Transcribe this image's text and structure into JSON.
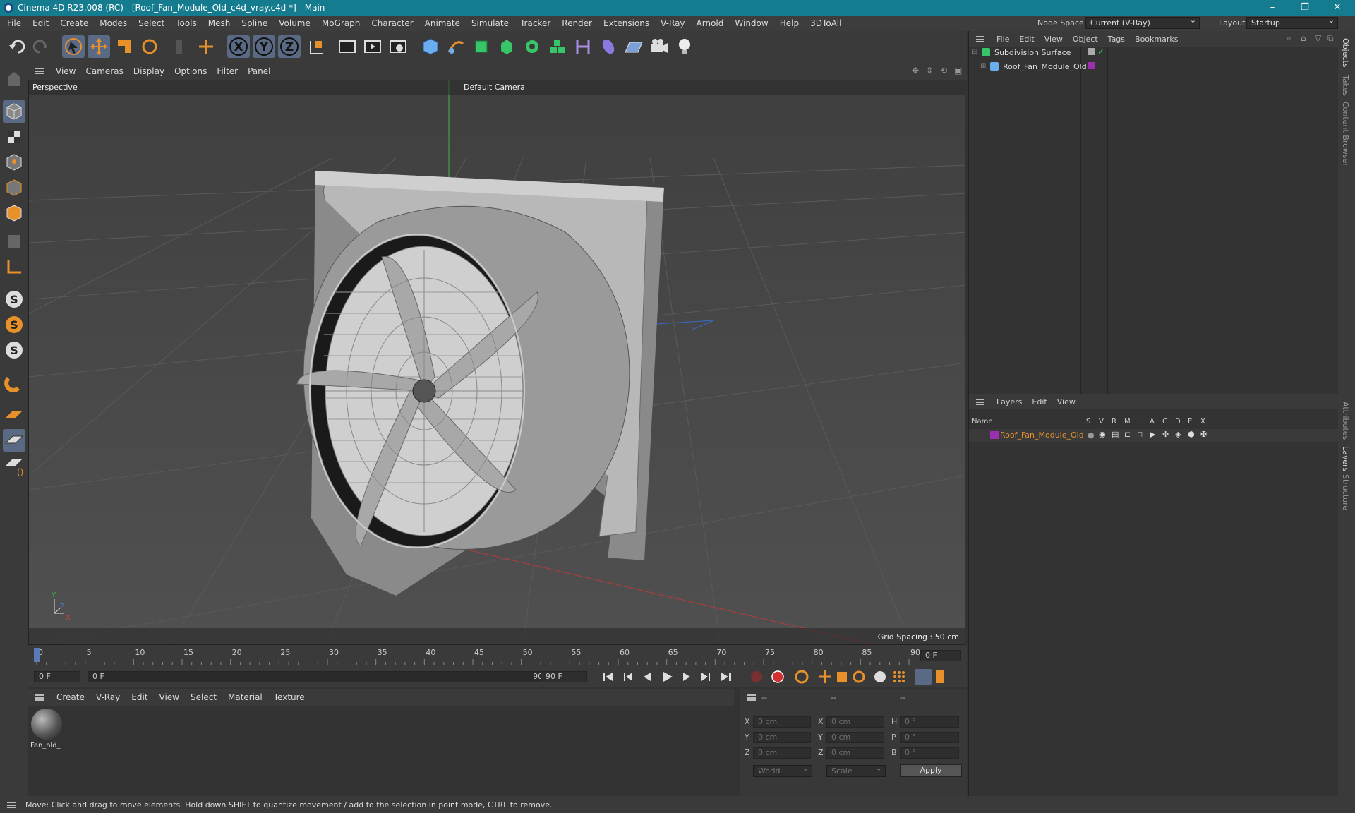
{
  "window": {
    "title": "Cinema 4D R23.008 (RC) - [Roof_Fan_Module_Old_c4d_vray.c4d *] - Main",
    "minimize": "–",
    "restore": "❐",
    "close": "✕"
  },
  "menu": {
    "items": [
      "File",
      "Edit",
      "Create",
      "Modes",
      "Select",
      "Tools",
      "Mesh",
      "Spline",
      "Volume",
      "MoGraph",
      "Character",
      "Animate",
      "Simulate",
      "Tracker",
      "Render",
      "Extensions",
      "V-Ray",
      "Arnold",
      "Window",
      "Help",
      "3DToAll"
    ],
    "node_space_label": "Node Space:",
    "node_space_value": "Current (V-Ray)",
    "layout_label": "Layout:",
    "layout_value": "Startup"
  },
  "toolbar": {
    "axis_x": "X",
    "axis_y": "Y",
    "axis_z": "Z"
  },
  "viewport": {
    "menu": [
      "View",
      "Cameras",
      "Display",
      "Options",
      "Filter",
      "Panel"
    ],
    "view_name": "Perspective",
    "camera": "Default Camera",
    "grid_spacing": "Grid Spacing : 50 cm",
    "axis_labels": {
      "x": "X",
      "y": "Y",
      "z": "Z"
    }
  },
  "timeline": {
    "ticks": [
      "0",
      "5",
      "10",
      "15",
      "20",
      "25",
      "30",
      "35",
      "40",
      "45",
      "50",
      "55",
      "60",
      "65",
      "70",
      "75",
      "80",
      "85",
      "90"
    ],
    "current_frame_field": "0 F",
    "playhead": 0,
    "max": 90
  },
  "transport": {
    "start": "0 F",
    "range_start": "0 F",
    "range_end": "90 F",
    "end": "90 F"
  },
  "material": {
    "menu": [
      "Create",
      "V-Ray",
      "Edit",
      "View",
      "Select",
      "Material",
      "Texture"
    ],
    "items": [
      {
        "name": "Fan_old_"
      }
    ]
  },
  "coords": {
    "header": [
      "--",
      "--",
      "--"
    ],
    "rows": [
      {
        "l1": "X",
        "v1": "0 cm",
        "l2": "X",
        "v2": "0 cm",
        "l3": "H",
        "v3": "0 °"
      },
      {
        "l1": "Y",
        "v1": "0 cm",
        "l2": "Y",
        "v2": "0 cm",
        "l3": "P",
        "v3": "0 °"
      },
      {
        "l1": "Z",
        "v1": "0 cm",
        "l2": "Z",
        "v2": "0 cm",
        "l3": "B",
        "v3": "0 °"
      }
    ],
    "world": "World",
    "scale": "Scale",
    "apply": "Apply"
  },
  "objects": {
    "menu": [
      "File",
      "Edit",
      "View",
      "Object",
      "Tags",
      "Bookmarks"
    ],
    "tree": [
      {
        "name": "Subdivision Surface",
        "depth": 0
      },
      {
        "name": "Roof_Fan_Module_Old",
        "depth": 1
      }
    ]
  },
  "layers": {
    "menu": [
      "Layers",
      "Edit",
      "View"
    ],
    "columns": [
      "Name",
      "S",
      "V",
      "R",
      "M",
      "L",
      "A",
      "G",
      "D",
      "E",
      "X"
    ],
    "rows": [
      {
        "name": "Roof_Fan_Module_Old",
        "color": "#9b2fae"
      }
    ]
  },
  "side_tabs": [
    "Objects",
    "Takes",
    "Content Browser",
    "Attributes",
    "Layers",
    "Structure"
  ],
  "status": "Move: Click and drag to move elements. Hold down SHIFT to quantize movement / add to the selection in point mode, CTRL to remove.",
  "colors": {
    "title": "#157c8f",
    "accent_orange": "#e8902a",
    "layer_name": "#e8902a",
    "selection_blue": "#5a6a85"
  }
}
